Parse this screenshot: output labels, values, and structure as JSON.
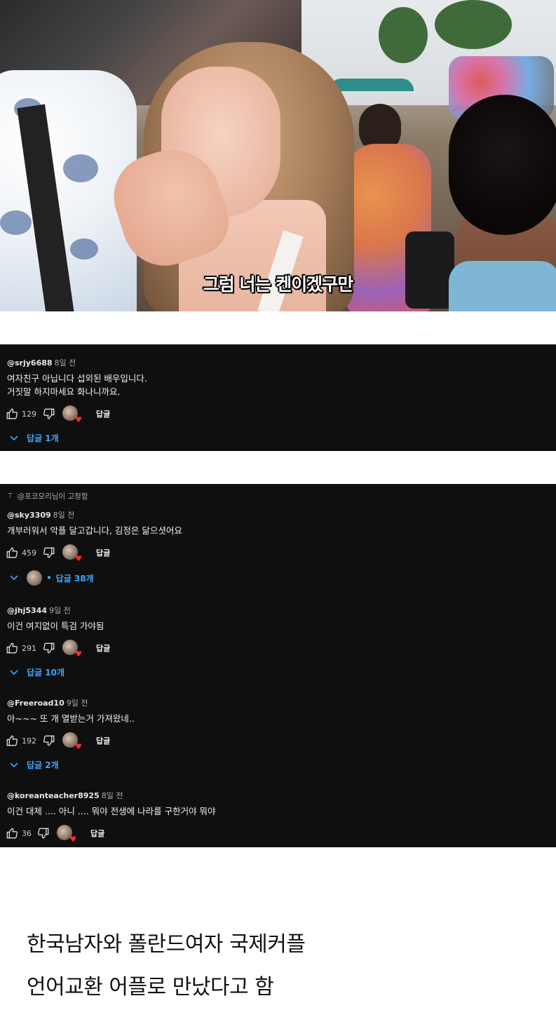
{
  "video": {
    "subtitle": "그럼 너는 켄이겠구만"
  },
  "comment1": {
    "author": "@srjy6688",
    "time": "8일 전",
    "text_line1": "여자친구 아닙니다 섭외된 배우입니다.",
    "text_line2": "거짓말 하지마세요 화나니까요.",
    "likes": "129",
    "reply_label": "답글",
    "replies": "답글 1개"
  },
  "pinned": {
    "label": "@포코모리님이 고정함"
  },
  "comment2": {
    "author": "@sky3309",
    "time": "8일 전",
    "text": "개부러워서 악플 달고갑니다, 김정은 닮으셧어요",
    "likes": "459",
    "reply_label": "답글",
    "replies": "답글 38개"
  },
  "comment3": {
    "author": "@jhj5344",
    "time": "9일 전",
    "text": "이건 여지없이 특검 가야됨",
    "likes": "291",
    "reply_label": "답글",
    "replies": "답글 10개"
  },
  "comment4": {
    "author": "@Freeroad10",
    "time": "9일 전",
    "text": "아~~~ 또 개 열받는거 가져왔네..",
    "likes": "192",
    "reply_label": "답글",
    "replies": "답글 2개"
  },
  "comment5": {
    "author": "@koreanteacher8925",
    "time": "8일 전",
    "text": "이건 대체 .... 아니 .... 뭐야 전생에 나라를 구한거야 뭐야",
    "likes": "36",
    "reply_label": "답글"
  },
  "caption": {
    "line1": "한국남자와 폴란드여자 국제커플",
    "line2": "언어교환 어플로 만났다고 함"
  },
  "colors": {
    "panel_bg": "#0f0f0f",
    "link_blue": "#3ea6ff",
    "heart_red": "#ff2b2b"
  },
  "icons": [
    "thumbs-up-icon",
    "thumbs-down-icon",
    "chevron-down-icon",
    "heart-icon",
    "pin-icon"
  ]
}
